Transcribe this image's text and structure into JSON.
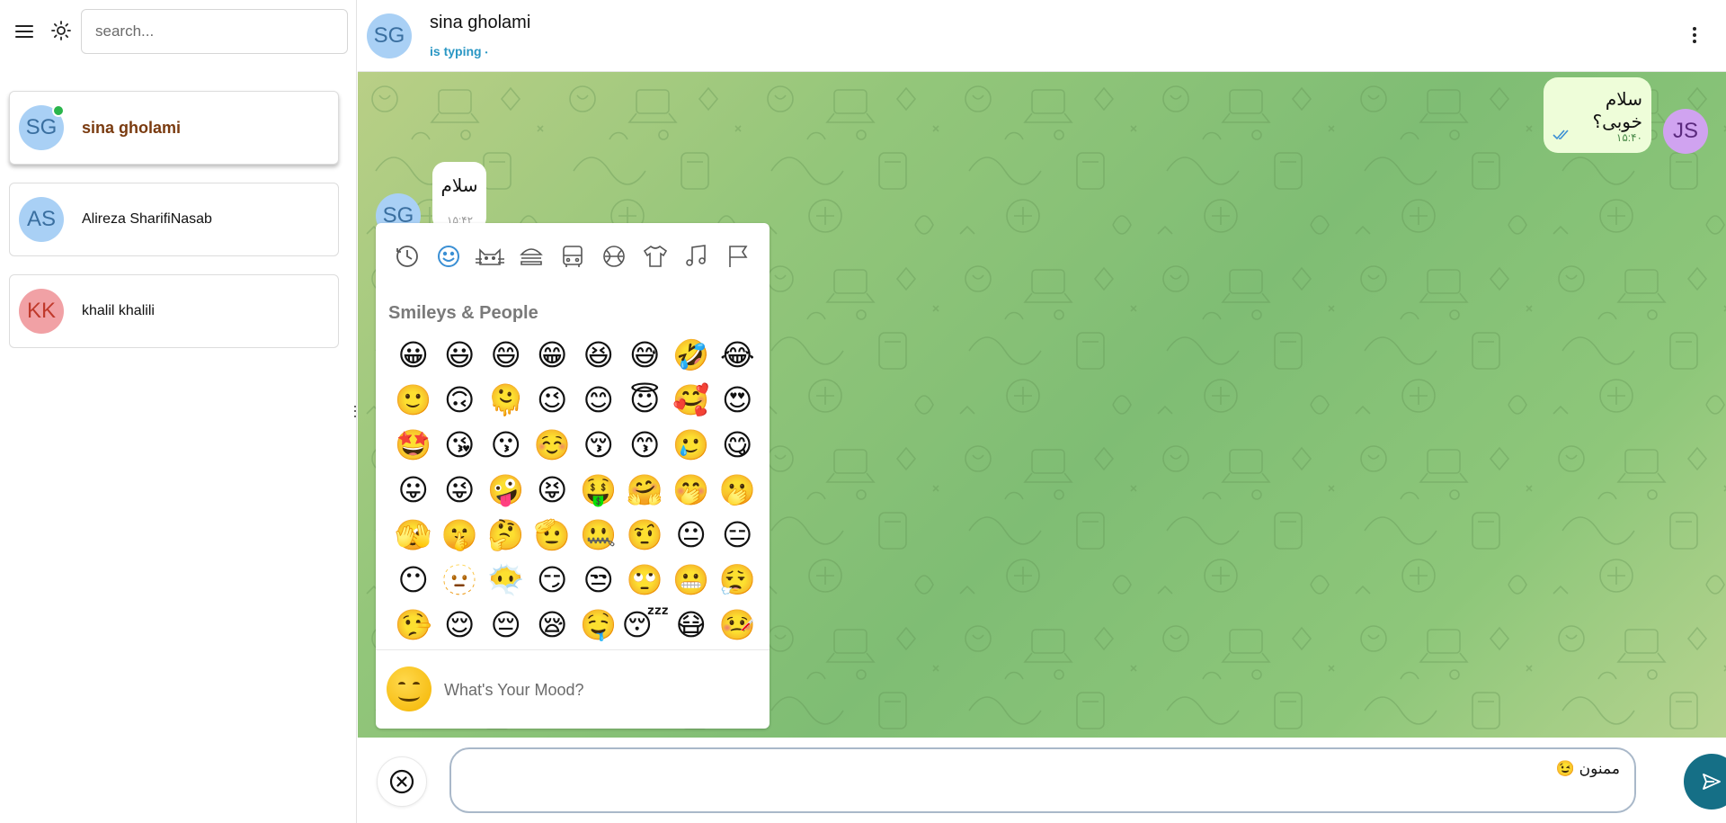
{
  "sidebar": {
    "search_placeholder": "search...",
    "chats": [
      {
        "initials": "SG",
        "name": "sina gholami",
        "avatar_bg": "#a9d0f5",
        "avatar_fg": "#3a6fa0",
        "online": true,
        "active": true
      },
      {
        "initials": "AS",
        "name": "Alireza SharifiNasab",
        "avatar_bg": "#a9d0f5",
        "avatar_fg": "#3a6fa0",
        "online": false,
        "active": false
      },
      {
        "initials": "KK",
        "name": "khalil khalili",
        "avatar_bg": "#f1a1a5",
        "avatar_fg": "#c0392b",
        "online": false,
        "active": false
      }
    ]
  },
  "header": {
    "initials": "SG",
    "name": "sina gholami",
    "status": "is typing",
    "status_dot": "•"
  },
  "messages": {
    "outgoing": {
      "text": "سلام خوبی؟",
      "time": "۱۵:۴۰",
      "sender_initials": "JS"
    },
    "incoming": {
      "text": "سلام",
      "time": "۱۵:۴۲",
      "sender_initials": "SG"
    }
  },
  "emoji_picker": {
    "categories": [
      "recent-icon",
      "smiley-icon",
      "animal-icon",
      "food-icon",
      "travel-icon",
      "activity-icon",
      "objects-icon",
      "symbols-icon",
      "flag-icon"
    ],
    "active_category": "smiley-icon",
    "section_title": "Smileys & People",
    "emojis": [
      "😀",
      "😃",
      "😄",
      "😁",
      "😆",
      "😅",
      "🤣",
      "😂",
      "🙂",
      "🙃",
      "🫠",
      "😉",
      "😊",
      "😇",
      "🥰",
      "😍",
      "🤩",
      "😘",
      "😗",
      "☺️",
      "😚",
      "😙",
      "🥲",
      "😋",
      "😛",
      "😜",
      "🤪",
      "😝",
      "🤑",
      "🤗",
      "🤭",
      "🫢",
      "🫣",
      "🤫",
      "🤔",
      "🫡",
      "🤐",
      "🤨",
      "😐",
      "😑",
      "😶",
      "🫥",
      "😶‍🌫️",
      "😏",
      "😒",
      "🙄",
      "😬",
      "😮‍💨",
      "🤥",
      "😌",
      "😔",
      "😪",
      "🤤",
      "😴",
      "😷",
      "🤒"
    ],
    "mood_placeholder": "What's Your Mood?"
  },
  "composer": {
    "value": "ممنون 😉"
  },
  "colors": {
    "accent": "#156f86",
    "status": "#2a97c4",
    "online": "#2ab54b",
    "active_name": "#7a3b10",
    "bubble_out": "#eefdd9"
  }
}
